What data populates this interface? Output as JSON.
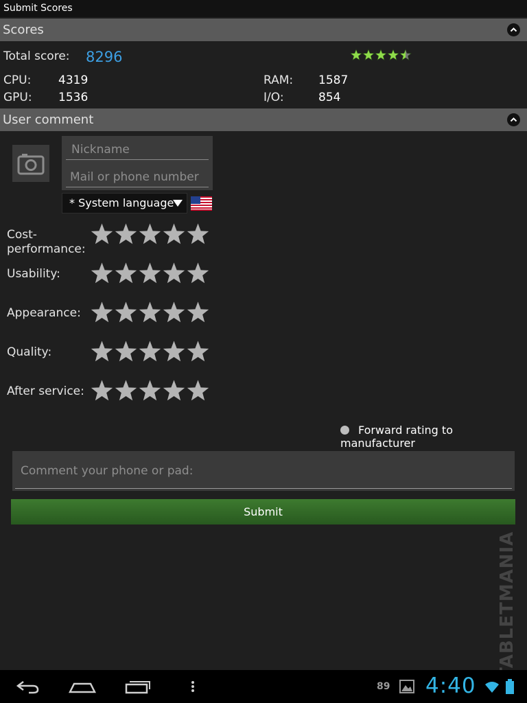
{
  "app": {
    "title": "Submit Scores"
  },
  "scores": {
    "header": "Scores",
    "total_label": "Total score:",
    "total_value": "8296",
    "star_rating": 4.5,
    "cpu_label": "CPU:",
    "cpu_value": "4319",
    "gpu_label": "GPU:",
    "gpu_value": "1536",
    "ram_label": "RAM:",
    "ram_value": "1587",
    "io_label": "I/O:",
    "io_value": "854"
  },
  "comment_section": {
    "header": "User comment",
    "nickname_placeholder": "Nickname",
    "contact_placeholder": "Mail or phone number",
    "language_value": "* System language",
    "ratings": [
      {
        "label_line1": "Cost-",
        "label_line2": "performance:",
        "stars": 0
      },
      {
        "label": "Usability:",
        "stars": 0
      },
      {
        "label": "Appearance:",
        "stars": 0
      },
      {
        "label": "Quality:",
        "stars": 0
      },
      {
        "label": "After service:",
        "stars": 0
      }
    ],
    "forward_label": "Forward rating to manufacturer",
    "comment_placeholder": "Comment your phone or pad:",
    "submit_label": "Submit"
  },
  "watermark": "TABLETMANIA",
  "status_bar": {
    "notification_count": "89",
    "clock": "4:40"
  },
  "colors": {
    "accent": "#3d9fe3",
    "submit": "#2f6b24",
    "rated_star": "#8fdc4a",
    "empty_star": "#b4b4b4"
  }
}
